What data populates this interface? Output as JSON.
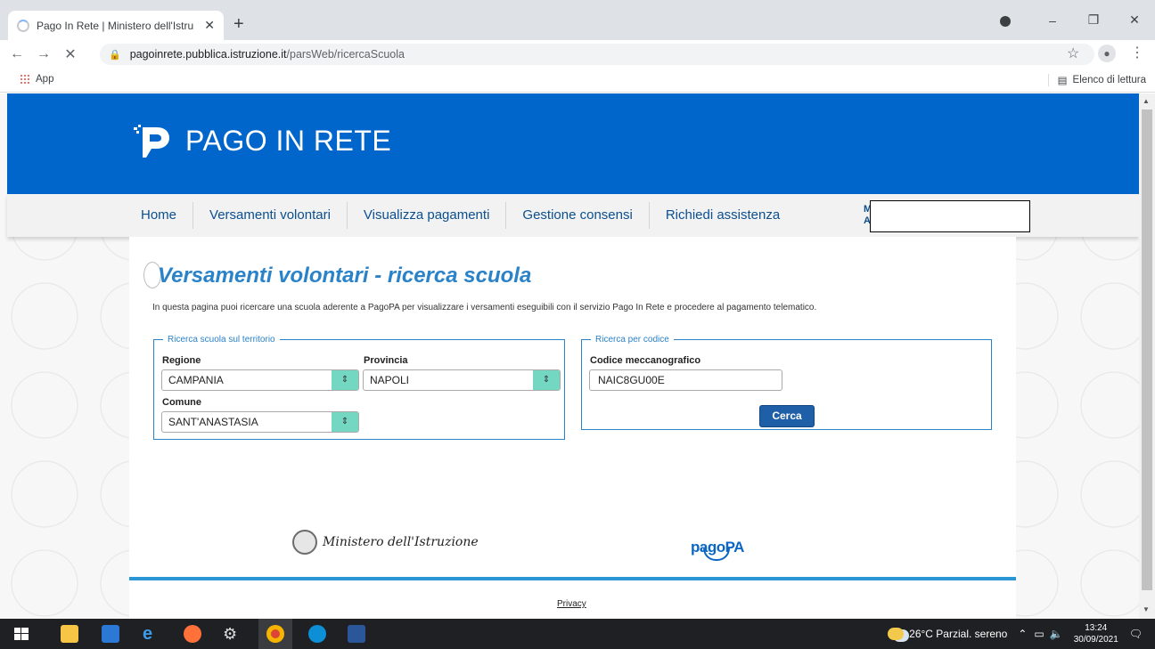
{
  "browser": {
    "tab_title": "Pago In Rete | Ministero dell'Istru",
    "tab_close": "✕",
    "new_tab": "+",
    "url_domain": "pagoinrete.pubblica.istruzione.it",
    "url_path": "/parsWeb/ricercaScuola",
    "bookmark_apps": "App",
    "reading_list": "Elenco di lettura",
    "back_icon": "←",
    "forward_icon": "→",
    "stop_icon": "✕",
    "minimize": "–",
    "maximize": "❐",
    "close": "✕",
    "star": "☆",
    "menu": "⋮"
  },
  "site": {
    "logo_text": "PAGO IN RETE",
    "nav": [
      "Home",
      "Versamenti volontari",
      "Visualizza pagamenti",
      "Gestione consensi",
      "Richiedi assistenza"
    ],
    "user_initials": "M\nA"
  },
  "content": {
    "title": "Versamenti volontari - ricerca scuola",
    "description": "In questa pagina puoi ricercare una scuola aderente a PagoPA per visualizzare i versamenti eseguibili con il servizio Pago In Rete e procedere al pagamento telematico.",
    "territorio": {
      "legend": "Ricerca scuola sul territorio",
      "regione_label": "Regione",
      "regione_value": "CAMPANIA",
      "provincia_label": "Provincia",
      "provincia_value": "NAPOLI",
      "comune_label": "Comune",
      "comune_value": "SANT'ANASTASIA"
    },
    "codice": {
      "legend": "Ricerca per codice",
      "label": "Codice meccanografico",
      "value": "NAIC8GU00E",
      "button": "Cerca"
    }
  },
  "footer": {
    "ministero": "Ministero dell'Istruzione",
    "pagopa": "pagoPA",
    "privacy": "Privacy"
  },
  "taskbar": {
    "weather": "26°C  Parzial. sereno",
    "time": "13:24",
    "date": "30/09/2021"
  },
  "colors": {
    "header": "#0066cc",
    "accent": "#2a82c9",
    "select_arrow": "#74d7c2",
    "button": "#1f5fa8"
  }
}
